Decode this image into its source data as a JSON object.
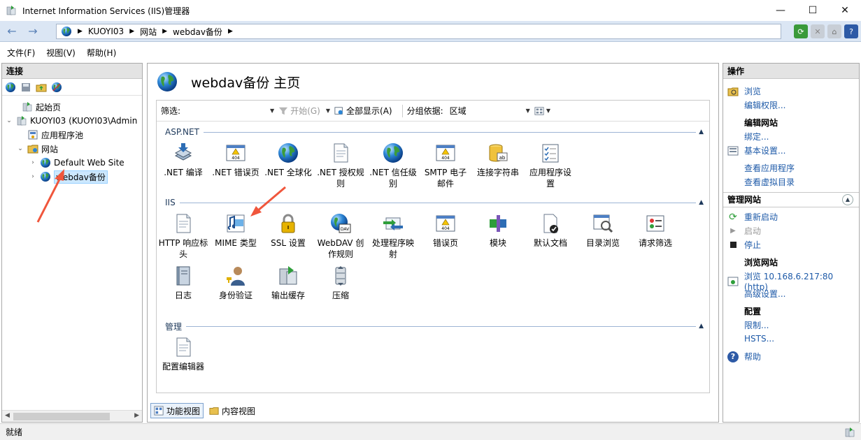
{
  "window": {
    "title": "Internet Information Services (IIS)管理器",
    "minimize": "—",
    "maximize": "☐",
    "close": "✕"
  },
  "address": {
    "segments": [
      "KUOYI03",
      "网站",
      "webdav备份"
    ]
  },
  "menu": {
    "items": [
      "文件(F)",
      "视图(V)",
      "帮助(H)"
    ]
  },
  "connections": {
    "header": "连接",
    "tree": [
      {
        "label": "起始页",
        "icon": "start-page-icon"
      },
      {
        "label": "KUOYI03 (KUOYI03\\Admin",
        "icon": "server-icon"
      },
      {
        "label": "应用程序池",
        "icon": "app-pool-icon"
      },
      {
        "label": "网站",
        "icon": "sites-folder-icon"
      },
      {
        "label": "Default Web Site",
        "icon": "globe-icon"
      },
      {
        "label": "webdav备份",
        "icon": "globe-icon"
      }
    ]
  },
  "center": {
    "title": "webdav备份 主页",
    "filter": {
      "label": "筛选:",
      "start": "开始(G)",
      "show_all": "全部显示(A)",
      "group_by_label": "分组依据:",
      "group_by_value": "区域"
    },
    "groups": {
      "aspnet": {
        "title": "ASP.NET",
        "features": [
          {
            "line1": ".NET 编译",
            "line2": ""
          },
          {
            "line1": ".NET 错误页",
            "line2": ""
          },
          {
            "line1": ".NET 全球化",
            "line2": ""
          },
          {
            "line1": ".NET 授权规",
            "line2": "则"
          },
          {
            "line1": ".NET 信任级",
            "line2": "别"
          },
          {
            "line1": "SMTP 电子",
            "line2": "邮件"
          },
          {
            "line1": "连接字符串",
            "line2": ""
          },
          {
            "line1": "应用程序设",
            "line2": "置"
          }
        ]
      },
      "iis": {
        "title": "IIS",
        "features": [
          {
            "line1": "HTTP 响应标",
            "line2": "头"
          },
          {
            "line1": "MIME 类型",
            "line2": ""
          },
          {
            "line1": "SSL 设置",
            "line2": ""
          },
          {
            "line1": "WebDAV 创",
            "line2": "作规则"
          },
          {
            "line1": "处理程序映",
            "line2": "射"
          },
          {
            "line1": "错误页",
            "line2": ""
          },
          {
            "line1": "模块",
            "line2": ""
          },
          {
            "line1": "默认文档",
            "line2": ""
          },
          {
            "line1": "目录浏览",
            "line2": ""
          },
          {
            "line1": "请求筛选",
            "line2": ""
          },
          {
            "line1": "日志",
            "line2": ""
          },
          {
            "line1": "身份验证",
            "line2": ""
          },
          {
            "line1": "输出缓存",
            "line2": ""
          },
          {
            "line1": "压缩",
            "line2": ""
          }
        ]
      },
      "management": {
        "title": "管理",
        "features": [
          {
            "line1": "配置编辑器",
            "line2": ""
          }
        ]
      }
    },
    "view_tabs": {
      "features": "功能视图",
      "content": "内容视图"
    }
  },
  "actions": {
    "header": "操作",
    "browse": "浏览",
    "edit_permissions": "编辑权限...",
    "edit_site": "编辑网站",
    "bindings": "绑定...",
    "basic_settings": "基本设置...",
    "view_applications": "查看应用程序",
    "view_virtual_dirs": "查看虚拟目录",
    "manage_site": "管理网站",
    "restart": "重新启动",
    "start": "启动",
    "stop": "停止",
    "browse_site": "浏览网站",
    "browse_address": "浏览 10.168.6.217:80 (http)",
    "advanced_settings": "高级设置...",
    "config": "配置",
    "limits": "限制...",
    "hsts": "HSTS...",
    "help": "帮助"
  },
  "status": {
    "text": "就绪"
  },
  "colors": {
    "link": "#1e5aa8",
    "annotation_arrow": "#f0563c",
    "group_header": "#1e395b"
  }
}
